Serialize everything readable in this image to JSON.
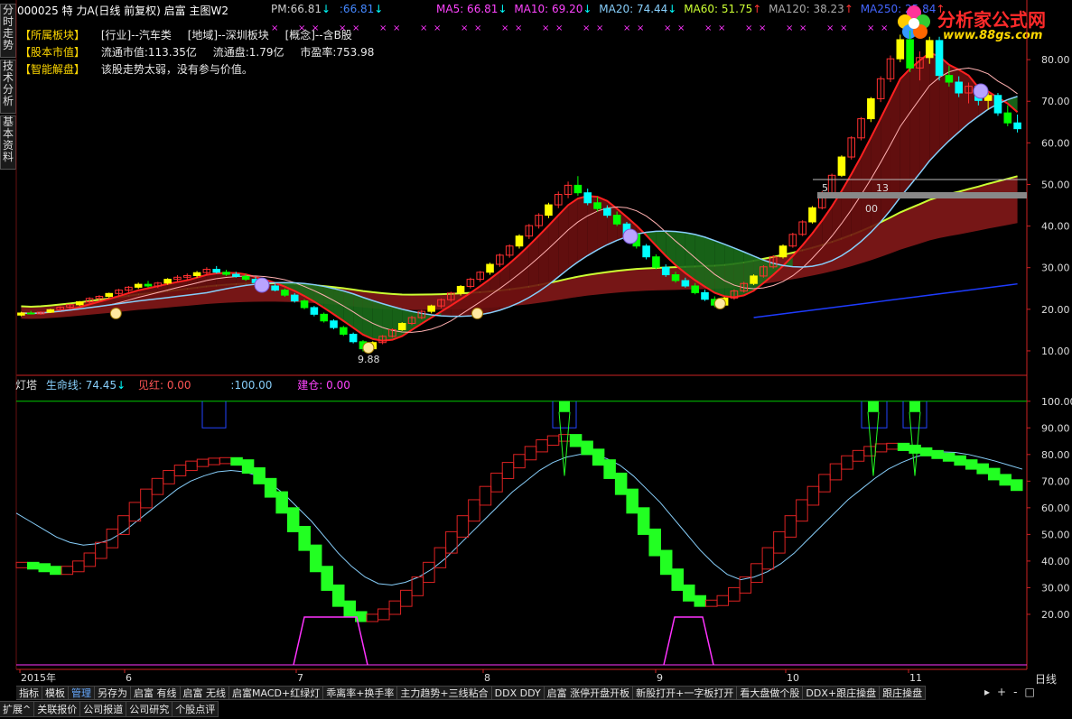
{
  "header": {
    "stock": "000025 特 力A",
    "mode": "(日线 前复权)",
    "template": "启富 主图W2",
    "pm_label": "PM:",
    "pm_value": "66.81",
    "pm_value2": ":66.81",
    "ma5": "MA5: 66.81",
    "ma10": "MA10: 69.20",
    "ma20": "MA20: 74.44",
    "ma60": "MA60: 51.75",
    "ma120": "MA120: 38.23",
    "ma250": "MA250: 25.84"
  },
  "info": {
    "sector_tag": "【所属板块】",
    "industry": "[行业]--汽车类",
    "region": "[地域]--深圳板块",
    "concept": "[概念]--含B股",
    "market_tag": "【股本市值】",
    "market_cap": "流通市值:113.35亿",
    "float_shares": "流通盘:1.79亿",
    "pe": "市盈率:753.98",
    "ai_tag": "【智能解盘】",
    "ai_text": "该股走势太弱，没有参与价值。"
  },
  "side_tabs": [
    "分时走势",
    "技术分析",
    "基本资料"
  ],
  "brand": {
    "name": "分析家公式网",
    "url": "www.88gs.com"
  },
  "colors": {
    "up": "#ff3030",
    "down": "#00ffff",
    "yellow": "#ffff00",
    "green": "#00ff00",
    "red_fill": "#8b1a1a",
    "green_fill": "#1a6b1a",
    "axis": "#cc2222",
    "ma_light": "#87cefa",
    "ma_yellow": "#ccff33",
    "ma_blue": "#1e3cff",
    "magenta": "#ff33ff"
  },
  "chart_data": [
    {
      "type": "candlestick",
      "title": "启富 主图W2",
      "ylim": [
        5,
        90
      ],
      "yticks": [
        10,
        20,
        30,
        40,
        50,
        60,
        70,
        80
      ],
      "annotations": [
        "9.88",
        "5",
        "13",
        "00"
      ],
      "ohlc": [
        [
          18.6,
          19.4,
          18.3,
          19.1
        ],
        [
          19.1,
          19.6,
          18.8,
          18.9
        ],
        [
          18.9,
          19.5,
          18.7,
          19.3
        ],
        [
          19.3,
          20.1,
          19.1,
          19.9
        ],
        [
          19.9,
          20.7,
          19.6,
          20.5
        ],
        [
          20.5,
          21.3,
          20.2,
          21.1
        ],
        [
          21.1,
          22.0,
          20.8,
          21.8
        ],
        [
          21.8,
          22.9,
          21.5,
          22.6
        ],
        [
          22.6,
          23.4,
          22.0,
          23.1
        ],
        [
          23.1,
          24.0,
          22.7,
          23.8
        ],
        [
          23.8,
          24.9,
          23.3,
          24.6
        ],
        [
          24.6,
          25.6,
          24.1,
          25.3
        ],
        [
          25.3,
          26.4,
          24.9,
          26.0
        ],
        [
          26.0,
          26.8,
          25.2,
          25.6
        ],
        [
          25.6,
          26.6,
          25.1,
          26.3
        ],
        [
          26.3,
          27.5,
          25.9,
          27.2
        ],
        [
          27.2,
          28.2,
          26.6,
          27.7
        ],
        [
          27.7,
          28.6,
          27.0,
          28.1
        ],
        [
          28.1,
          29.2,
          27.6,
          28.8
        ],
        [
          28.8,
          30.1,
          28.2,
          29.6
        ],
        [
          29.6,
          30.4,
          28.6,
          28.9
        ],
        [
          28.9,
          29.5,
          28.0,
          28.4
        ],
        [
          28.4,
          29.0,
          27.6,
          27.9
        ],
        [
          27.9,
          28.5,
          26.8,
          27.2
        ],
        [
          27.2,
          27.8,
          26.0,
          26.4
        ],
        [
          26.4,
          27.0,
          25.3,
          25.6
        ],
        [
          25.6,
          26.2,
          24.3,
          24.6
        ],
        [
          24.6,
          25.0,
          23.0,
          23.4
        ],
        [
          23.4,
          23.9,
          21.6,
          22.0
        ],
        [
          22.0,
          22.4,
          20.0,
          20.4
        ],
        [
          20.4,
          20.8,
          18.3,
          18.8
        ],
        [
          18.8,
          19.2,
          16.8,
          17.2
        ],
        [
          17.2,
          17.6,
          15.2,
          15.6
        ],
        [
          15.6,
          16.0,
          13.6,
          14.0
        ],
        [
          14.0,
          14.4,
          11.8,
          12.2
        ],
        [
          12.2,
          12.6,
          9.88,
          10.5
        ],
        [
          10.5,
          12.3,
          10.2,
          12.0
        ],
        [
          12.0,
          13.8,
          11.6,
          13.5
        ],
        [
          13.5,
          15.4,
          13.2,
          15.1
        ],
        [
          15.1,
          16.9,
          14.8,
          16.6
        ],
        [
          16.6,
          18.4,
          16.2,
          18.0
        ],
        [
          18.0,
          19.8,
          17.6,
          19.5
        ],
        [
          19.5,
          21.1,
          19.0,
          20.8
        ],
        [
          20.8,
          22.6,
          20.3,
          22.3
        ],
        [
          22.3,
          24.2,
          21.8,
          23.9
        ],
        [
          23.9,
          25.8,
          23.3,
          25.5
        ],
        [
          25.5,
          27.6,
          25.0,
          27.2
        ],
        [
          27.2,
          29.2,
          26.6,
          28.9
        ],
        [
          28.9,
          31.2,
          28.3,
          30.8
        ],
        [
          30.8,
          33.4,
          30.2,
          33.0
        ],
        [
          33.0,
          35.6,
          32.4,
          35.2
        ],
        [
          35.2,
          38.0,
          34.6,
          37.6
        ],
        [
          37.6,
          40.5,
          36.9,
          40.1
        ],
        [
          40.1,
          43.1,
          39.4,
          42.6
        ],
        [
          42.6,
          45.6,
          41.9,
          45.1
        ],
        [
          45.1,
          48.3,
          44.3,
          47.6
        ],
        [
          47.6,
          50.7,
          46.7,
          49.8
        ],
        [
          49.8,
          52.0,
          47.3,
          48.0
        ],
        [
          48.0,
          49.0,
          45.0,
          45.6
        ],
        [
          45.6,
          47.0,
          43.5,
          44.2
        ],
        [
          44.2,
          45.0,
          42.0,
          42.6
        ],
        [
          42.6,
          43.5,
          40.0,
          40.5
        ],
        [
          40.5,
          41.0,
          37.4,
          38.0
        ],
        [
          38.0,
          38.5,
          34.6,
          35.2
        ],
        [
          35.2,
          35.7,
          32.0,
          32.6
        ],
        [
          32.6,
          33.2,
          29.6,
          30.1
        ],
        [
          30.1,
          30.8,
          27.8,
          28.3
        ],
        [
          28.3,
          29.0,
          26.4,
          26.9
        ],
        [
          26.9,
          27.6,
          25.2,
          25.6
        ],
        [
          25.6,
          26.3,
          23.6,
          24.0
        ],
        [
          24.0,
          24.7,
          22.0,
          22.4
        ],
        [
          22.4,
          23.1,
          20.5,
          21.0
        ],
        [
          21.0,
          23.0,
          20.6,
          22.7
        ],
        [
          22.7,
          24.8,
          22.3,
          24.4
        ],
        [
          24.4,
          26.6,
          24.0,
          26.2
        ],
        [
          26.2,
          28.4,
          25.8,
          28.0
        ],
        [
          28.0,
          30.6,
          27.6,
          30.2
        ],
        [
          30.2,
          33.0,
          29.8,
          32.6
        ],
        [
          32.6,
          35.6,
          32.2,
          35.2
        ],
        [
          35.2,
          38.4,
          34.8,
          38.0
        ],
        [
          38.0,
          41.4,
          37.6,
          41.0
        ],
        [
          41.0,
          44.8,
          40.6,
          44.4
        ],
        [
          44.4,
          48.4,
          44.0,
          48.0
        ],
        [
          48.0,
          52.6,
          47.6,
          52.2
        ],
        [
          52.2,
          57.0,
          51.8,
          56.6
        ],
        [
          56.6,
          61.6,
          56.0,
          61.2
        ],
        [
          61.2,
          66.2,
          60.6,
          65.8
        ],
        [
          65.8,
          71.0,
          65.0,
          70.6
        ],
        [
          70.6,
          76.0,
          69.8,
          75.4
        ],
        [
          75.4,
          81.0,
          74.6,
          80.2
        ],
        [
          80.2,
          86.0,
          79.4,
          84.8
        ],
        [
          84.8,
          87.0,
          77.0,
          78.0
        ],
        [
          78.0,
          82.0,
          75.0,
          80.5
        ],
        [
          80.5,
          85.5,
          79.0,
          84.6
        ],
        [
          84.6,
          85.5,
          75.0,
          76.2
        ],
        [
          76.2,
          78.5,
          73.5,
          74.6
        ],
        [
          74.6,
          76.0,
          71.0,
          72.0
        ],
        [
          72.0,
          74.5,
          69.5,
          73.6
        ],
        [
          73.6,
          74.0,
          69.0,
          70.2
        ],
        [
          70.2,
          72.0,
          68.0,
          71.4
        ],
        [
          71.4,
          72.0,
          66.5,
          67.2
        ],
        [
          67.2,
          69.0,
          64.0,
          64.8
        ],
        [
          64.8,
          66.8,
          62.5,
          63.4
        ]
      ]
    },
    {
      "type": "line",
      "title": "灯塔",
      "series_labels": [
        {
          "name": "生命线",
          "value": "74.45"
        },
        {
          "name": "见红",
          "value": "0.00"
        },
        {
          "name": "",
          "value": "100.00"
        },
        {
          "name": "建仓",
          "value": "0.00"
        }
      ],
      "ylim": [
        0,
        105
      ],
      "yticks": [
        20,
        30,
        40,
        50,
        60,
        70,
        80,
        90,
        100
      ],
      "ladder": [
        38.5,
        38,
        37,
        36,
        37,
        39,
        42,
        46,
        51,
        56,
        61,
        66,
        70,
        73,
        75,
        76.5,
        77.2,
        77.6,
        77.8,
        77,
        74,
        70,
        65,
        59,
        52,
        45,
        37,
        30,
        24,
        20,
        18.3,
        19,
        21,
        24,
        28,
        33,
        38.5,
        44,
        50,
        56,
        62,
        67,
        72,
        76,
        79,
        82,
        84.5,
        86,
        86.5,
        84,
        81,
        77,
        72,
        66,
        59,
        51,
        43,
        36,
        30,
        26,
        24,
        24.3,
        26,
        29,
        33,
        38,
        44,
        50,
        56,
        62,
        67,
        71.5,
        75.5,
        78.5,
        80.5,
        82,
        83,
        83.2,
        82.5,
        81.5,
        80.5,
        79.5,
        78.5,
        77,
        75.5,
        73.8,
        71.5,
        69.5,
        67.5
      ],
      "lifeline": [
        58,
        55,
        52,
        49,
        47,
        46,
        46.5,
        48,
        51,
        55,
        59,
        63,
        67,
        70,
        72,
        73.5,
        74,
        73.5,
        72,
        69,
        65,
        60,
        55,
        49,
        43,
        38,
        34,
        31.5,
        31,
        32,
        34,
        37,
        41,
        46,
        51,
        56,
        61,
        66,
        70,
        74,
        77,
        79,
        80,
        80,
        78.5,
        76,
        72,
        67,
        62,
        56,
        50,
        44,
        39,
        35,
        33,
        34,
        36,
        39,
        43,
        48,
        53,
        58,
        63,
        67,
        71,
        74.5,
        77,
        79,
        80.5,
        81,
        80.8,
        80,
        78.8,
        77.5,
        76,
        74.5
      ]
    }
  ],
  "time_axis": {
    "labels": [
      "2015年",
      "6",
      "7",
      "8",
      "9",
      "10",
      "11"
    ],
    "period": "日线"
  },
  "tabs": [
    "指标",
    "模板",
    "管理",
    "另存为",
    "启富 有线",
    "启富 无线",
    "启富MACD+红绿灯",
    "乖离率+换手率",
    "主力趋势+三线粘合",
    "DDX DDY",
    "启富 涨停开盘开板",
    "新股打开+一字板打开",
    "看大盘做个股",
    "DDX+跟庄操盘",
    "跟庄操盘"
  ],
  "tab_active_index": 2,
  "bottom_tabs": [
    "扩展^",
    "关联报价",
    "公司报道",
    "公司研究",
    "个股点评"
  ],
  "tab_controls": [
    "▸",
    "+",
    "-",
    "□"
  ]
}
